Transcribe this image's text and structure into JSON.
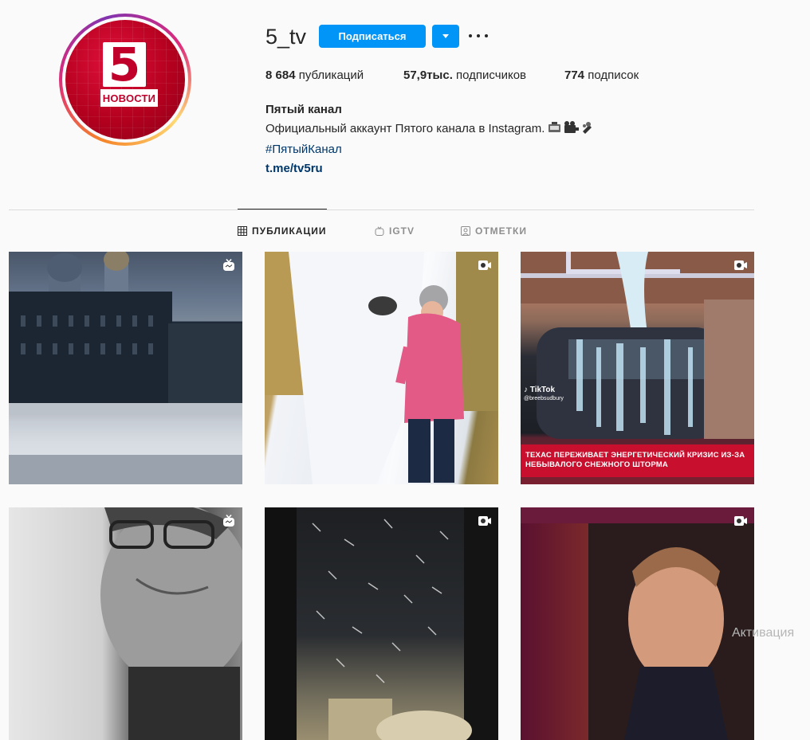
{
  "profile": {
    "avatar_logo_number": "5",
    "avatar_logo_text": "НОВОСТИ",
    "username": "5_tv",
    "follow_label": "Подписаться",
    "stats": {
      "posts_count": "8 684",
      "posts_label": "публикаций",
      "followers_count": "57,9тыс.",
      "followers_label": "подписчиков",
      "following_count": "774",
      "following_label": "подписок"
    },
    "bio": {
      "name": "Пятый канал",
      "description": "Официальный аккаунт Пятого канала в Instagram.",
      "hashtag": "#ПятыйКанал",
      "link": "t.me/tv5ru"
    }
  },
  "tabs": [
    {
      "label": "ПУБЛИКАЦИИ",
      "icon": "grid-icon",
      "active": true
    },
    {
      "label": "IGTV",
      "icon": "igtv-icon",
      "active": false
    },
    {
      "label": "ОТМЕТКИ",
      "icon": "tagged-icon",
      "active": false
    }
  ],
  "posts": [
    {
      "type": "igtv",
      "badge_icon": "igtv-icon"
    },
    {
      "type": "video",
      "badge_icon": "video-icon"
    },
    {
      "type": "video",
      "badge_icon": "video-icon",
      "caption": "ТЕХАС ПЕРЕЖИВАЕТ ЭНЕРГЕТИЧЕСКИЙ КРИЗИС ИЗ-ЗА НЕБЫВАЛОГО СНЕЖНОГО ШТОРМА",
      "tiktok_label": "TikTok",
      "tiktok_handle": "@breebsudbury"
    },
    {
      "type": "igtv",
      "badge_icon": "igtv-icon"
    },
    {
      "type": "video",
      "badge_icon": "video-icon"
    },
    {
      "type": "video",
      "badge_icon": "video-icon"
    }
  ],
  "system": {
    "watermark": "Активация"
  },
  "colors": {
    "primary_button": "#0095f6",
    "link": "#00376b",
    "brand_red": "#c0002a"
  }
}
